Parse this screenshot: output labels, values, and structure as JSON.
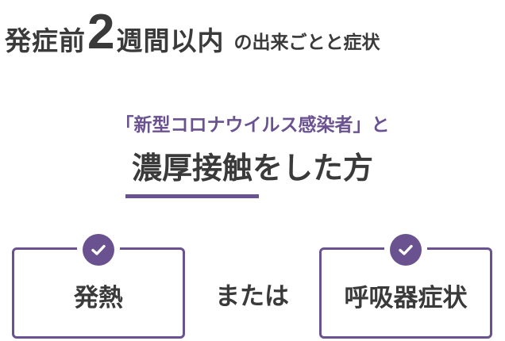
{
  "headline": {
    "prefix": "発症前",
    "number": "2",
    "suffix": "週間以内",
    "tail": "の出来ごとと症状"
  },
  "contact": {
    "line": "「新型コロナウイルス感染者」と",
    "method_key": "濃厚接触",
    "method_rest": "をした方"
  },
  "symptoms": {
    "left_label": "発熱",
    "connector": "または",
    "right_label": "呼吸器症状",
    "check_icon": "check-circle-icon"
  },
  "colors": {
    "accent": "#6a5290",
    "text": "#3a3a3a",
    "background": "#ffffff"
  }
}
